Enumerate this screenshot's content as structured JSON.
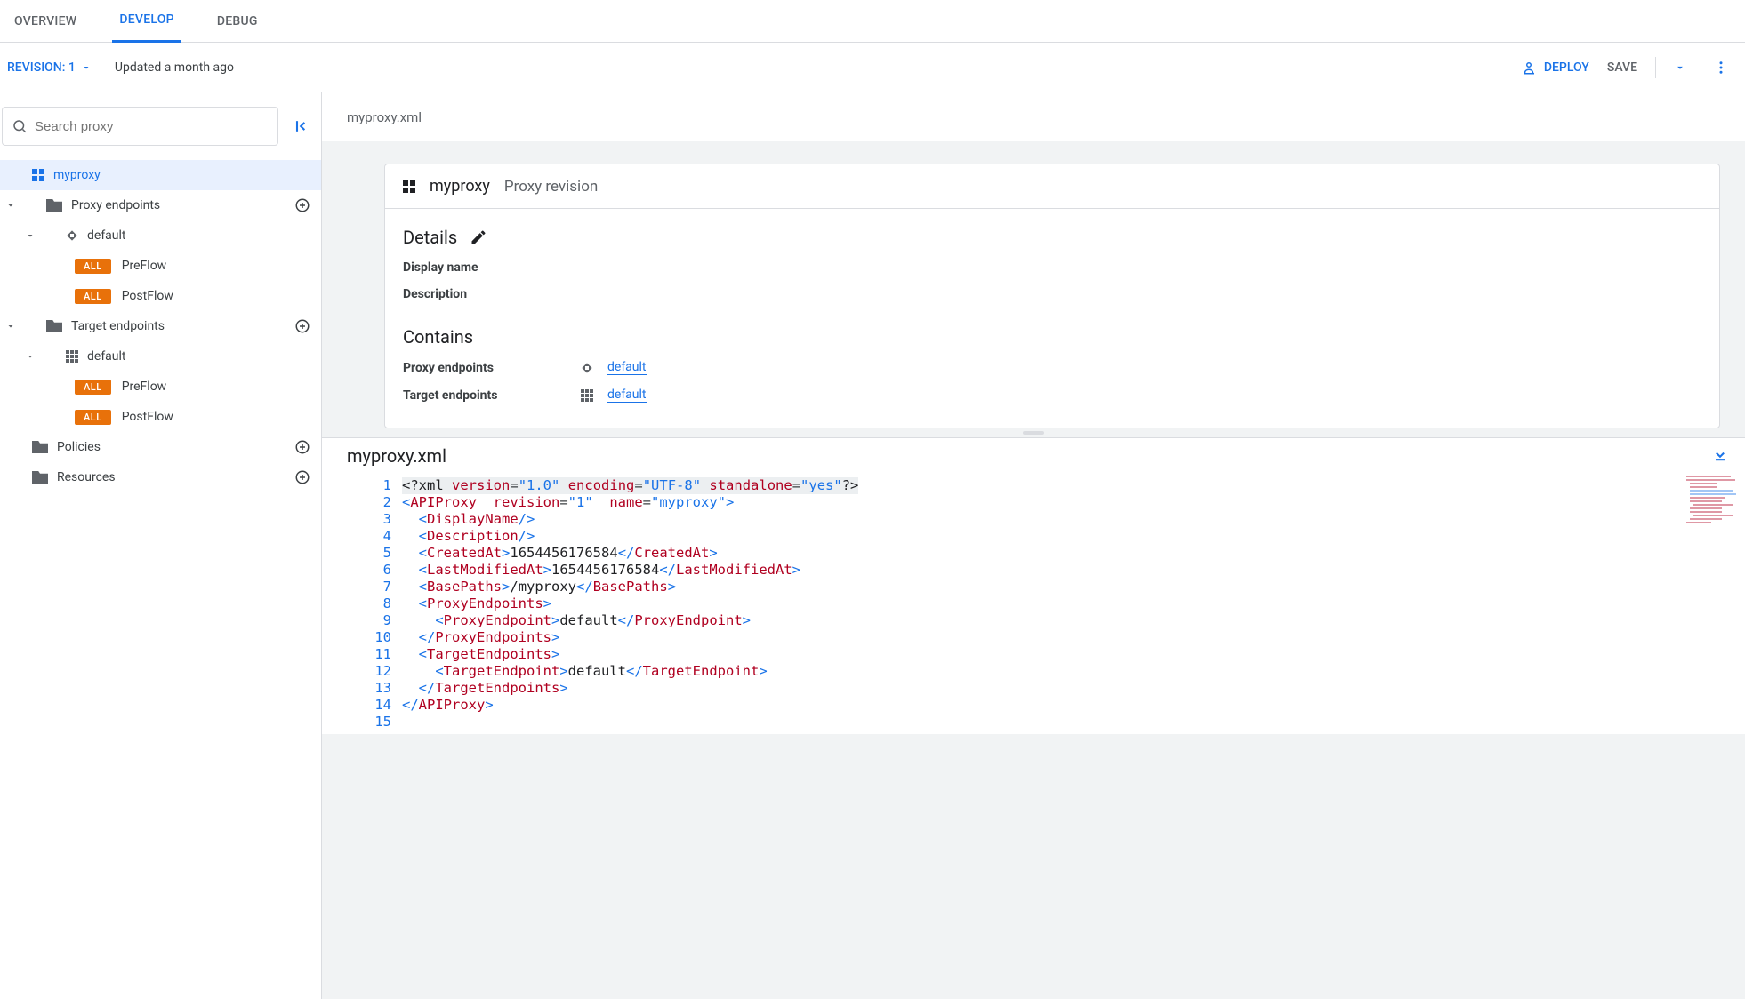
{
  "tabs": {
    "overview": "OVERVIEW",
    "develop": "DEVELOP",
    "debug": "DEBUG"
  },
  "subbar": {
    "revision_label": "REVISION: 1",
    "updated": "Updated a month ago",
    "deploy": "DEPLOY",
    "save": "SAVE"
  },
  "search": {
    "placeholder": "Search proxy"
  },
  "tree": {
    "root": "myproxy",
    "proxy_ep_label": "Proxy endpoints",
    "target_ep_label": "Target endpoints",
    "default": "default",
    "preflow": "PreFlow",
    "postflow": "PostFlow",
    "policies": "Policies",
    "resources": "Resources",
    "all_badge": "ALL"
  },
  "crumb": "myproxy.xml",
  "card": {
    "title": "myproxy",
    "subtitle": "Proxy revision",
    "details": "Details",
    "display_name": "Display name",
    "description": "Description",
    "contains": "Contains",
    "proxy_endpoints": "Proxy endpoints",
    "target_endpoints": "Target endpoints",
    "default_link": "default"
  },
  "editor": {
    "filename": "myproxy.xml",
    "lines": {
      "l1": "<?xml version=\"1.0\" encoding=\"UTF-8\" standalone=\"yes\"?>",
      "l2": "<APIProxy revision=\"1\" name=\"myproxy\">",
      "l3": "  <DisplayName/>",
      "l4": "  <Description/>",
      "l5": "  <CreatedAt>1654456176584</CreatedAt>",
      "l6": "  <LastModifiedAt>1654456176584</LastModifiedAt>",
      "l7": "  <BasePaths>/myproxy</BasePaths>",
      "l8": "  <ProxyEndpoints>",
      "l9": "    <ProxyEndpoint>default</ProxyEndpoint>",
      "l10": "  </ProxyEndpoints>",
      "l11": "  <TargetEndpoints>",
      "l12": "    <TargetEndpoint>default</TargetEndpoint>",
      "l13": "  </TargetEndpoints>",
      "l14": "</APIProxy>"
    },
    "gutter": [
      "1",
      "2",
      "3",
      "4",
      "5",
      "6",
      "7",
      "8",
      "9",
      "10",
      "11",
      "12",
      "13",
      "14",
      "15"
    ]
  }
}
